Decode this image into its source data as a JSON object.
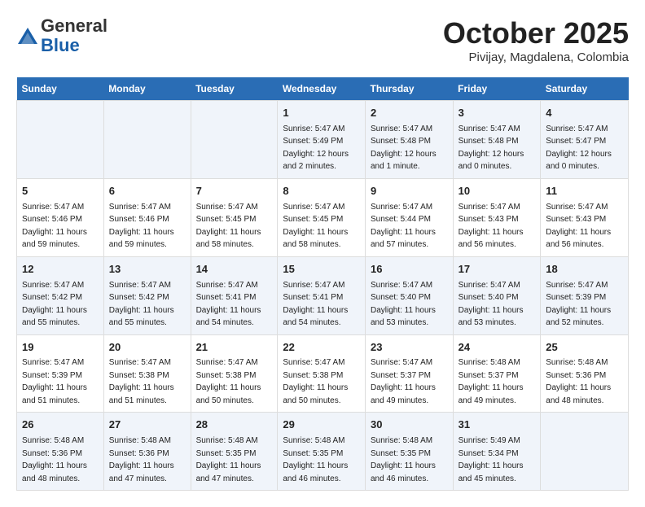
{
  "header": {
    "logo_general": "General",
    "logo_blue": "Blue",
    "month_title": "October 2025",
    "location": "Pivijay, Magdalena, Colombia"
  },
  "days_of_week": [
    "Sunday",
    "Monday",
    "Tuesday",
    "Wednesday",
    "Thursday",
    "Friday",
    "Saturday"
  ],
  "weeks": [
    [
      {
        "day": "",
        "info": ""
      },
      {
        "day": "",
        "info": ""
      },
      {
        "day": "",
        "info": ""
      },
      {
        "day": "1",
        "info": "Sunrise: 5:47 AM\nSunset: 5:49 PM\nDaylight: 12 hours\nand 2 minutes."
      },
      {
        "day": "2",
        "info": "Sunrise: 5:47 AM\nSunset: 5:48 PM\nDaylight: 12 hours\nand 1 minute."
      },
      {
        "day": "3",
        "info": "Sunrise: 5:47 AM\nSunset: 5:48 PM\nDaylight: 12 hours\nand 0 minutes."
      },
      {
        "day": "4",
        "info": "Sunrise: 5:47 AM\nSunset: 5:47 PM\nDaylight: 12 hours\nand 0 minutes."
      }
    ],
    [
      {
        "day": "5",
        "info": "Sunrise: 5:47 AM\nSunset: 5:46 PM\nDaylight: 11 hours\nand 59 minutes."
      },
      {
        "day": "6",
        "info": "Sunrise: 5:47 AM\nSunset: 5:46 PM\nDaylight: 11 hours\nand 59 minutes."
      },
      {
        "day": "7",
        "info": "Sunrise: 5:47 AM\nSunset: 5:45 PM\nDaylight: 11 hours\nand 58 minutes."
      },
      {
        "day": "8",
        "info": "Sunrise: 5:47 AM\nSunset: 5:45 PM\nDaylight: 11 hours\nand 58 minutes."
      },
      {
        "day": "9",
        "info": "Sunrise: 5:47 AM\nSunset: 5:44 PM\nDaylight: 11 hours\nand 57 minutes."
      },
      {
        "day": "10",
        "info": "Sunrise: 5:47 AM\nSunset: 5:43 PM\nDaylight: 11 hours\nand 56 minutes."
      },
      {
        "day": "11",
        "info": "Sunrise: 5:47 AM\nSunset: 5:43 PM\nDaylight: 11 hours\nand 56 minutes."
      }
    ],
    [
      {
        "day": "12",
        "info": "Sunrise: 5:47 AM\nSunset: 5:42 PM\nDaylight: 11 hours\nand 55 minutes."
      },
      {
        "day": "13",
        "info": "Sunrise: 5:47 AM\nSunset: 5:42 PM\nDaylight: 11 hours\nand 55 minutes."
      },
      {
        "day": "14",
        "info": "Sunrise: 5:47 AM\nSunset: 5:41 PM\nDaylight: 11 hours\nand 54 minutes."
      },
      {
        "day": "15",
        "info": "Sunrise: 5:47 AM\nSunset: 5:41 PM\nDaylight: 11 hours\nand 54 minutes."
      },
      {
        "day": "16",
        "info": "Sunrise: 5:47 AM\nSunset: 5:40 PM\nDaylight: 11 hours\nand 53 minutes."
      },
      {
        "day": "17",
        "info": "Sunrise: 5:47 AM\nSunset: 5:40 PM\nDaylight: 11 hours\nand 53 minutes."
      },
      {
        "day": "18",
        "info": "Sunrise: 5:47 AM\nSunset: 5:39 PM\nDaylight: 11 hours\nand 52 minutes."
      }
    ],
    [
      {
        "day": "19",
        "info": "Sunrise: 5:47 AM\nSunset: 5:39 PM\nDaylight: 11 hours\nand 51 minutes."
      },
      {
        "day": "20",
        "info": "Sunrise: 5:47 AM\nSunset: 5:38 PM\nDaylight: 11 hours\nand 51 minutes."
      },
      {
        "day": "21",
        "info": "Sunrise: 5:47 AM\nSunset: 5:38 PM\nDaylight: 11 hours\nand 50 minutes."
      },
      {
        "day": "22",
        "info": "Sunrise: 5:47 AM\nSunset: 5:38 PM\nDaylight: 11 hours\nand 50 minutes."
      },
      {
        "day": "23",
        "info": "Sunrise: 5:47 AM\nSunset: 5:37 PM\nDaylight: 11 hours\nand 49 minutes."
      },
      {
        "day": "24",
        "info": "Sunrise: 5:48 AM\nSunset: 5:37 PM\nDaylight: 11 hours\nand 49 minutes."
      },
      {
        "day": "25",
        "info": "Sunrise: 5:48 AM\nSunset: 5:36 PM\nDaylight: 11 hours\nand 48 minutes."
      }
    ],
    [
      {
        "day": "26",
        "info": "Sunrise: 5:48 AM\nSunset: 5:36 PM\nDaylight: 11 hours\nand 48 minutes."
      },
      {
        "day": "27",
        "info": "Sunrise: 5:48 AM\nSunset: 5:36 PM\nDaylight: 11 hours\nand 47 minutes."
      },
      {
        "day": "28",
        "info": "Sunrise: 5:48 AM\nSunset: 5:35 PM\nDaylight: 11 hours\nand 47 minutes."
      },
      {
        "day": "29",
        "info": "Sunrise: 5:48 AM\nSunset: 5:35 PM\nDaylight: 11 hours\nand 46 minutes."
      },
      {
        "day": "30",
        "info": "Sunrise: 5:48 AM\nSunset: 5:35 PM\nDaylight: 11 hours\nand 46 minutes."
      },
      {
        "day": "31",
        "info": "Sunrise: 5:49 AM\nSunset: 5:34 PM\nDaylight: 11 hours\nand 45 minutes."
      },
      {
        "day": "",
        "info": ""
      }
    ]
  ]
}
